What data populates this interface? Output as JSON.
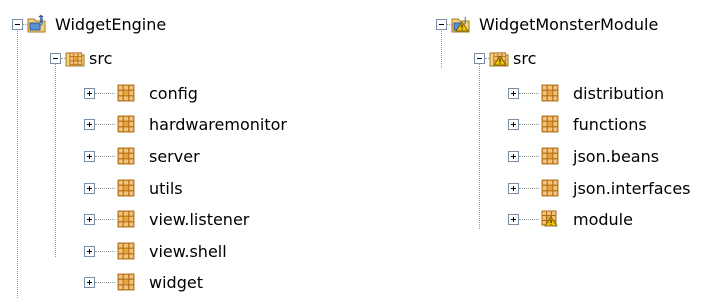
{
  "left_tree": {
    "project": {
      "label": "WidgetEngine",
      "icon": "java-project-icon"
    },
    "src": {
      "label": "src",
      "icon": "source-folder-icon"
    },
    "packages": [
      {
        "label": "config",
        "icon": "package-icon"
      },
      {
        "label": "hardwaremonitor",
        "icon": "package-icon"
      },
      {
        "label": "server",
        "icon": "package-icon"
      },
      {
        "label": "utils",
        "icon": "package-icon"
      },
      {
        "label": "view.listener",
        "icon": "package-icon"
      },
      {
        "label": "view.shell",
        "icon": "package-icon"
      },
      {
        "label": "widget",
        "icon": "package-icon"
      }
    ]
  },
  "right_tree": {
    "project": {
      "label": "WidgetMonsterModule",
      "icon": "java-project-warning-icon"
    },
    "src": {
      "label": "src",
      "icon": "source-folder-warning-icon"
    },
    "packages": [
      {
        "label": "distribution",
        "icon": "package-icon"
      },
      {
        "label": "functions",
        "icon": "package-icon"
      },
      {
        "label": "json.beans",
        "icon": "package-icon"
      },
      {
        "label": "json.interfaces",
        "icon": "package-icon"
      },
      {
        "label": "module",
        "icon": "package-warning-icon"
      }
    ]
  },
  "colors": {
    "expander_border": "#7a8ea6",
    "package_fill": "#e8a33d",
    "warning_yellow": "#f5c400",
    "folder_blue": "#5b8fd6"
  }
}
